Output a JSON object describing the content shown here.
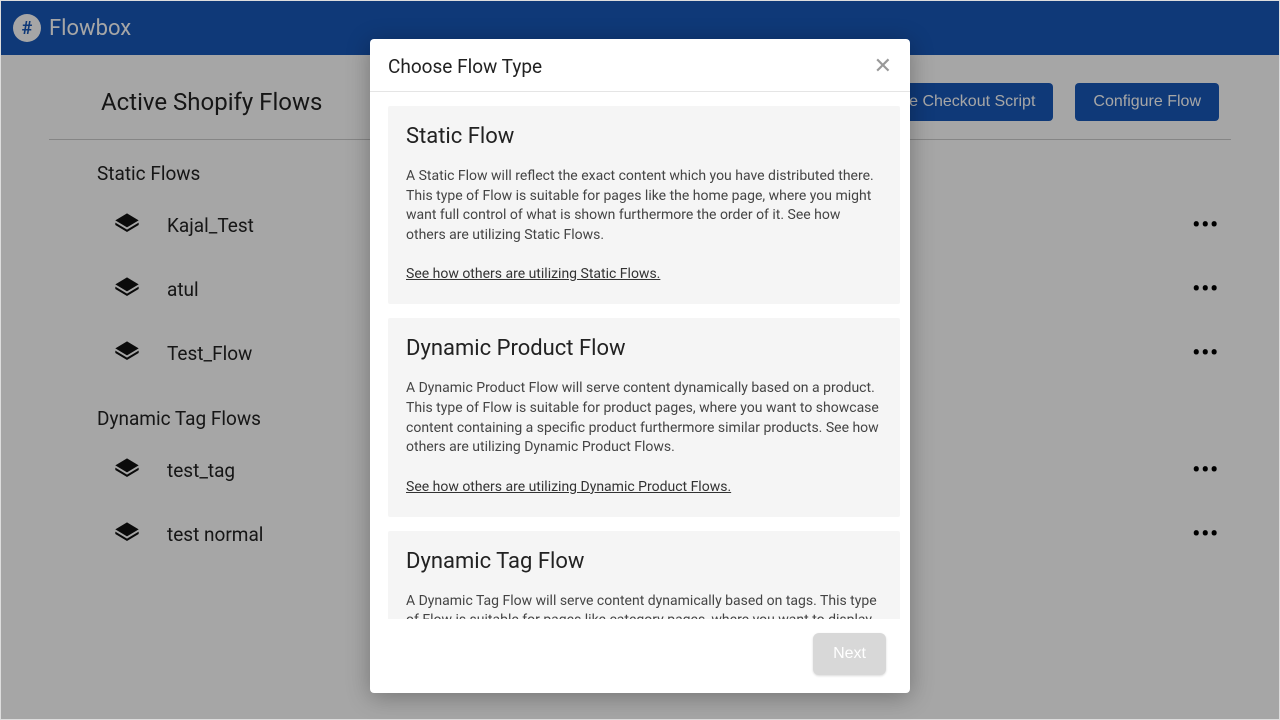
{
  "app_name": "Flowbox",
  "page_title": "Active Shopify Flows",
  "buttons": {
    "checkout": "Generate Checkout Script",
    "configure": "Configure Flow",
    "checkout_partial": "kout Script"
  },
  "sections": {
    "static": {
      "title": "Static Flows",
      "items": [
        "Kajal_Test",
        "atul",
        "Test_Flow"
      ]
    },
    "dynamic": {
      "title": "Dynamic Tag Flows",
      "items": [
        "test_tag",
        "test normal"
      ]
    }
  },
  "modal": {
    "title": "Choose Flow Type",
    "next": "Next",
    "cards": [
      {
        "title": "Static Flow",
        "body": "A Static Flow will reflect the exact content which you have distributed there. This type of Flow is suitable for pages like the home page, where you might want full control of what is shown furthermore the order of it. See how others are utilizing Static Flows.",
        "link": "See how others are utilizing Static Flows."
      },
      {
        "title": "Dynamic Product Flow",
        "body": "A Dynamic Product Flow will serve content dynamically based on a product. This type of Flow is suitable for product pages, where you want to showcase content containing a specific product furthermore similar products. See how others are utilizing Dynamic Product Flows.",
        "link": "See how others are utilizing Dynamic Product Flows."
      },
      {
        "title": "Dynamic Tag Flow",
        "body": "A Dynamic Tag Flow will serve content dynamically based on tags. This type of Flow is suitable for pages like category pages, where you want to display content related to a specific product category – or any other landing page where you want theme specific content.",
        "link": ""
      }
    ]
  }
}
